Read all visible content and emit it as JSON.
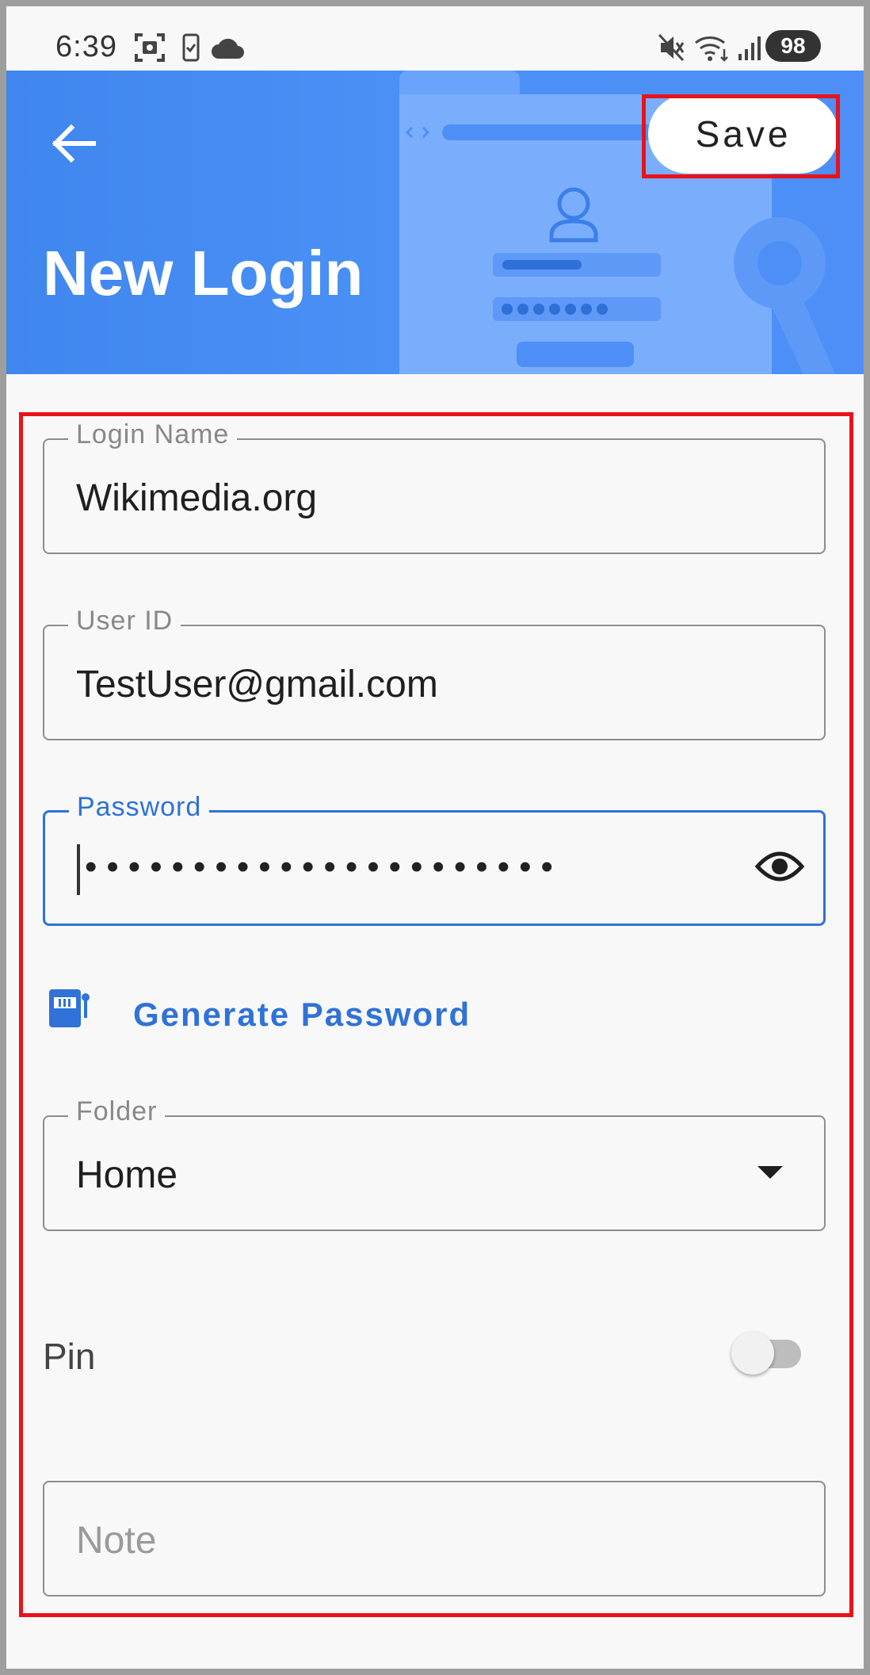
{
  "status_bar": {
    "time": "6:39",
    "battery": "98"
  },
  "header": {
    "title": "New Login",
    "save_label": "Save"
  },
  "form": {
    "login_name": {
      "label": "Login Name",
      "value": "Wikimedia.org"
    },
    "user_id": {
      "label": "User ID",
      "value": "TestUser@gmail.com"
    },
    "password": {
      "label": "Password",
      "masked_value": "••••••••••••••••••••••"
    },
    "generate_password": "Generate Password",
    "folder": {
      "label": "Folder",
      "value": "Home"
    },
    "pin": {
      "label": "Pin",
      "enabled": false
    },
    "note": {
      "placeholder": "Note"
    }
  },
  "colors": {
    "accent": "#2f72d8",
    "header_bg": "#4a90f5",
    "highlight": "#e8121b"
  }
}
